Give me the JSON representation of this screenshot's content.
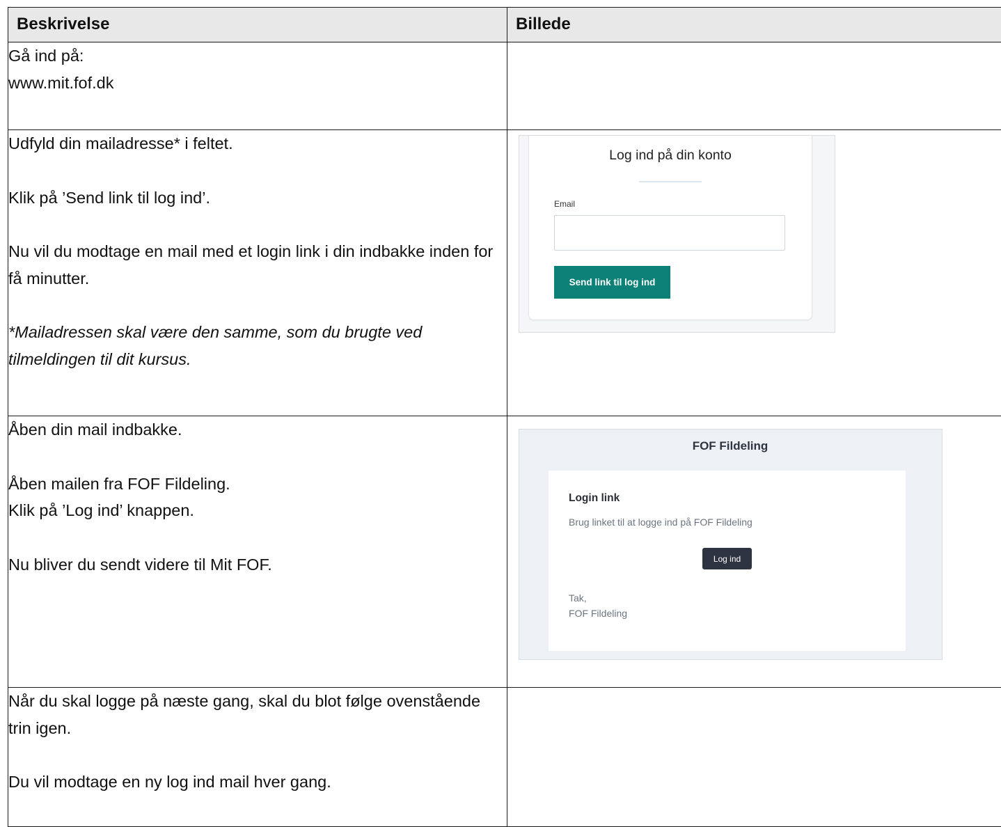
{
  "table": {
    "headers": [
      "Beskrivelse",
      "Billede"
    ],
    "rows": [
      {
        "lines": [
          "Gå ind på:",
          "www.mit.fof.dk"
        ]
      },
      {
        "lines": [
          "Udfyld din mailadresse* i feltet.",
          "Klik på ’Send link til log ind’.",
          "Nu vil du modtage en mail med et login link i din indbakke inden for få minutter.",
          "*Mailadressen skal være den samme, som du brugte ved tilmeldingen til dit kursus."
        ]
      },
      {
        "lines": [
          "Åben din mail indbakke.",
          "Åben mailen fra FOF Fildeling.",
          "Klik på ’Log ind’ knappen.",
          "Nu bliver du sendt videre til Mit FOF."
        ]
      },
      {
        "lines": [
          "Når du skal logge på næste gang, skal du blot følge ovenstående trin igen.",
          "Du vil modtage en ny log ind mail hver gang."
        ]
      }
    ]
  },
  "login_screenshot": {
    "title": "Log ind på din konto",
    "email_label": "Email",
    "email_value": "",
    "button_label": "Send link til log ind",
    "button_color": "#0b8177"
  },
  "email_screenshot": {
    "brand": "FOF Fildeling",
    "heading": "Login link",
    "text": "Brug linket til at logge ind på FOF Fildeling",
    "button_label": "Log ind",
    "button_color": "#2d3340",
    "sign_off_1": "Tak,",
    "sign_off_2": "FOF Fildeling"
  }
}
